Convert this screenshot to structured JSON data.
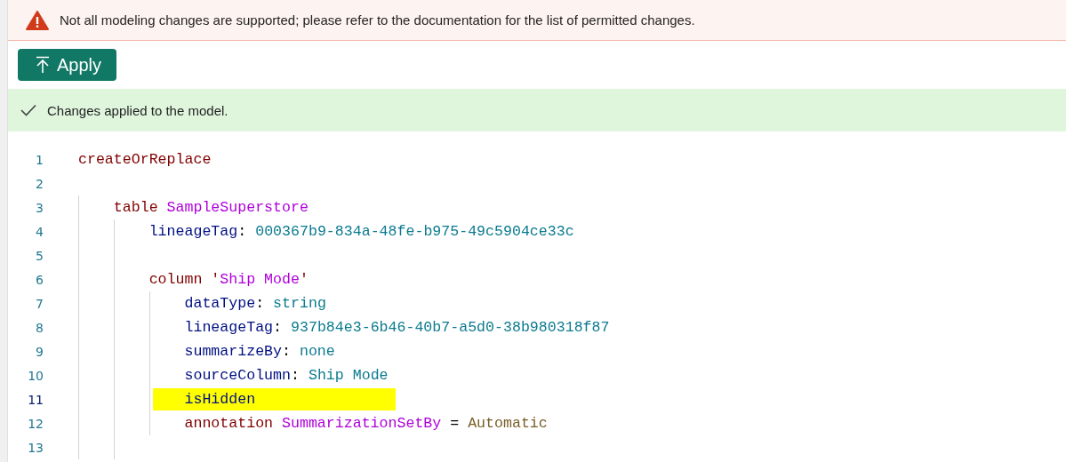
{
  "warning_bar": {
    "message": "Not all modeling changes are supported; please refer to the documentation for the list of permitted changes."
  },
  "apply_button": {
    "label": "Apply"
  },
  "success_bar": {
    "message": "Changes applied to the model."
  },
  "editor": {
    "lines": [
      {
        "number": "1",
        "highlighted": false,
        "tokens": [
          {
            "kind": "keyword",
            "text": "createOrReplace"
          }
        ]
      },
      {
        "number": "2",
        "highlighted": false
      },
      {
        "number": "3",
        "highlighted": false,
        "tokens": [
          {
            "kind": "keyword",
            "text": "    table"
          },
          {
            "kind": "name",
            "text": " SampleSuperstore"
          }
        ]
      },
      {
        "number": "4",
        "highlighted": false,
        "tokens": [
          {
            "kind": "property",
            "text": "        lineageTag"
          },
          {
            "kind": "punct",
            "text": ":"
          },
          {
            "kind": "value",
            "text": " 000367b9-834a-48fe-b975-49c5904ce33c"
          }
        ]
      },
      {
        "number": "5",
        "highlighted": false
      },
      {
        "number": "6",
        "highlighted": false,
        "tokens": [
          {
            "kind": "keyword",
            "text": "        column '"
          },
          {
            "kind": "name",
            "text": "Ship Mode"
          },
          {
            "kind": "keyword",
            "text": "'"
          }
        ]
      },
      {
        "number": "7",
        "highlighted": false,
        "tokens": [
          {
            "kind": "property",
            "text": "            dataType"
          },
          {
            "kind": "punct",
            "text": ":"
          },
          {
            "kind": "value",
            "text": " string"
          }
        ]
      },
      {
        "number": "8",
        "highlighted": false,
        "tokens": [
          {
            "kind": "property",
            "text": "            lineageTag"
          },
          {
            "kind": "punct",
            "text": ":"
          },
          {
            "kind": "value",
            "text": " 937b84e3-6b46-40b7-a5d0-38b980318f87"
          }
        ]
      },
      {
        "number": "9",
        "highlighted": false,
        "tokens": [
          {
            "kind": "property",
            "text": "            summarizeBy"
          },
          {
            "kind": "punct",
            "text": ":"
          },
          {
            "kind": "value",
            "text": " none"
          }
        ]
      },
      {
        "number": "10",
        "highlighted": false,
        "tokens": [
          {
            "kind": "property",
            "text": "            sourceColumn"
          },
          {
            "kind": "punct",
            "text": ":"
          },
          {
            "kind": "value",
            "text": " Ship Mode"
          }
        ]
      },
      {
        "number": "11",
        "highlighted": true,
        "tokens": [
          {
            "kind": "property",
            "text": "            isHidden"
          }
        ]
      },
      {
        "number": "12",
        "highlighted": false,
        "tokens": [
          {
            "kind": "keyword",
            "text": "            annotation"
          },
          {
            "kind": "name",
            "text": " SummarizationSetBy"
          },
          {
            "kind": "punct",
            "text": " = "
          },
          {
            "kind": "enum",
            "text": "Automatic"
          }
        ]
      },
      {
        "number": "13",
        "highlighted": false
      }
    ]
  }
}
